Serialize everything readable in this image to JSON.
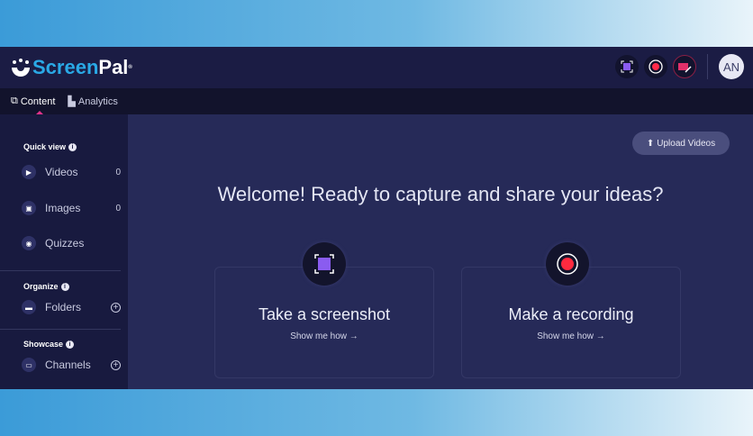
{
  "header": {
    "brand_a": "Screen",
    "brand_b": "Pal",
    "avatar": "AN"
  },
  "tabs": [
    {
      "label": "Content"
    },
    {
      "label": "Analytics"
    }
  ],
  "sidebar": {
    "quick_view": "Quick view",
    "items": [
      {
        "label": "Videos",
        "count": "0"
      },
      {
        "label": "Images",
        "count": "0"
      },
      {
        "label": "Quizzes"
      }
    ],
    "organize": "Organize",
    "folders": "Folders",
    "showcase": "Showcase",
    "channels": "Channels"
  },
  "main": {
    "upload": "Upload Videos",
    "welcome": "Welcome! Ready to capture and share your ideas?",
    "cards": [
      {
        "title": "Take a screenshot",
        "link": "Show me how →"
      },
      {
        "title": "Make a recording",
        "link": "Show me how →"
      }
    ]
  }
}
